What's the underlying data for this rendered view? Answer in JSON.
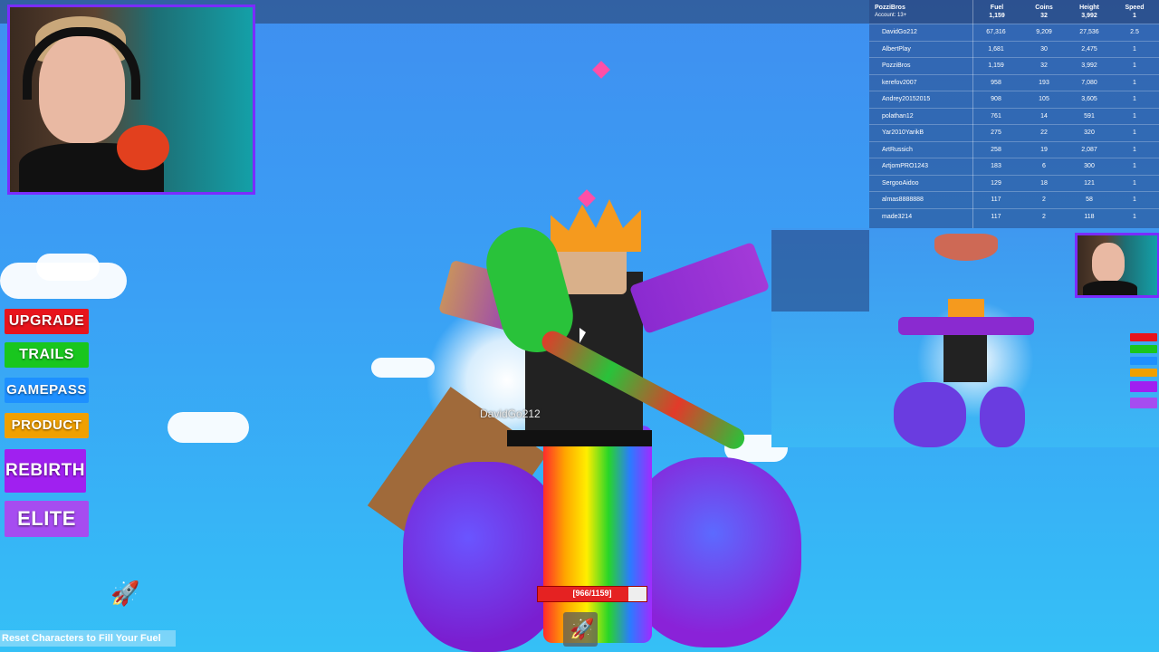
{
  "leaderboard": {
    "account_name": "PozziBros",
    "account_sub": "Account: 13+",
    "columns": [
      "Fuel",
      "Coins",
      "Height",
      "Speed"
    ],
    "me": {
      "fuel": "1,159",
      "coins": "32",
      "height": "3,992",
      "speed": "1"
    },
    "rows": [
      {
        "name": "DavidGo212",
        "fuel": "67,316",
        "coins": "9,209",
        "height": "27,536",
        "speed": "2.5"
      },
      {
        "name": "AlbertPlay",
        "fuel": "1,681",
        "coins": "30",
        "height": "2,475",
        "speed": "1"
      },
      {
        "name": "PozziBros",
        "fuel": "1,159",
        "coins": "32",
        "height": "3,992",
        "speed": "1"
      },
      {
        "name": "kerefov2007",
        "fuel": "958",
        "coins": "193",
        "height": "7,080",
        "speed": "1"
      },
      {
        "name": "Andrey20152015",
        "fuel": "908",
        "coins": "105",
        "height": "3,605",
        "speed": "1"
      },
      {
        "name": "polathan12",
        "fuel": "761",
        "coins": "14",
        "height": "591",
        "speed": "1"
      },
      {
        "name": "Yar2010YarikB",
        "fuel": "275",
        "coins": "22",
        "height": "320",
        "speed": "1"
      },
      {
        "name": "ArtRussich",
        "fuel": "258",
        "coins": "19",
        "height": "2,087",
        "speed": "1"
      },
      {
        "name": "ArtjomPRO1243",
        "fuel": "183",
        "coins": "6",
        "height": "300",
        "speed": "1"
      },
      {
        "name": "SergooAidoo",
        "fuel": "129",
        "coins": "18",
        "height": "121",
        "speed": "1"
      },
      {
        "name": "almas8888888",
        "fuel": "117",
        "coins": "2",
        "height": "58",
        "speed": "1"
      },
      {
        "name": "made3214",
        "fuel": "117",
        "coins": "2",
        "height": "118",
        "speed": "1"
      }
    ]
  },
  "menu": {
    "upgrade": "UPGRADE",
    "trails": "TRAILS",
    "gamepass": "GAMEPASS",
    "product": "PRODUCT",
    "rebirth": "REBIRTH",
    "elite": "ELITE"
  },
  "colors": {
    "upgrade": "#e8141c",
    "trails": "#19c61e",
    "gamepass": "#1e90ff",
    "product": "#f0a000",
    "rebirth": "#a020f0",
    "elite": "#a64cf0",
    "webcam_border": "#7a2cff"
  },
  "player": {
    "name_tag": "DavidGo212",
    "fuel_label": "[966/1159]",
    "fuel_fraction": 0.833
  },
  "hint": "Reset Characters to Fill Your Fuel",
  "hotbar_icon": "rocket-icon"
}
